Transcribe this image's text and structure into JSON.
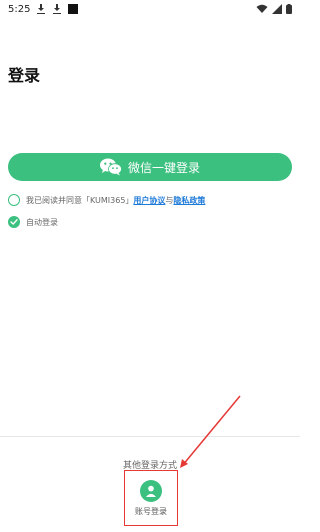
{
  "status_bar": {
    "time": "5:25"
  },
  "page": {
    "title": "登录"
  },
  "wechat_login": {
    "label": "微信一键登录"
  },
  "agreement": {
    "prefix": "我已阅读并同意「KUMI365」",
    "user_agreement": "用户协议",
    "and": "与",
    "privacy_policy": "隐私政策",
    "checked": false
  },
  "auto_login": {
    "label": "自动登录",
    "checked": true
  },
  "other_methods": {
    "title": "其他登录方式",
    "account_login_label": "账号登录"
  },
  "colors": {
    "brand_green": "#3cc07f",
    "link_blue": "#1e7ad8",
    "annotation_red": "#e53935"
  }
}
